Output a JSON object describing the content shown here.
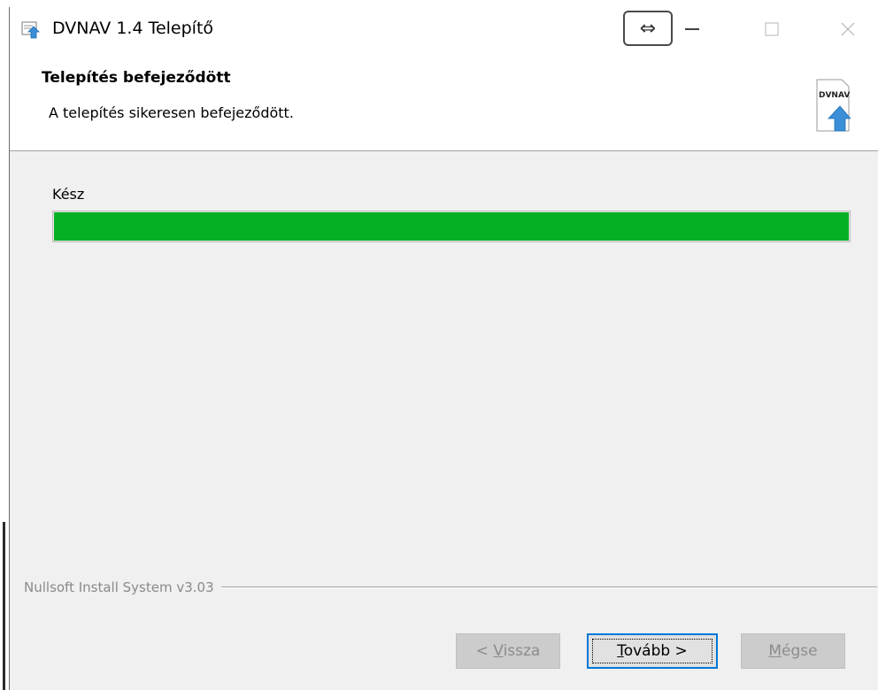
{
  "window": {
    "title": "DVNAV 1.4 Telepítő"
  },
  "titlebar": {
    "resize_toggle_glyph": "⇔",
    "icons": {
      "app": "installer-icon",
      "minimize": "minimize-icon",
      "maximize": "maximize-icon",
      "close": "close-icon"
    }
  },
  "header": {
    "title": "Telepítés befejeződött",
    "subtitle": "A telepítés sikeresen befejeződött.",
    "logo_text": "DVNAV"
  },
  "content": {
    "status_label": "Kész",
    "progress_percent": 100,
    "progress_color": "#06b025"
  },
  "footer": {
    "branding": "Nullsoft Install System v3.03",
    "buttons": {
      "back": {
        "prefix": "< ",
        "mnemonic": "V",
        "rest": "issza",
        "enabled": false
      },
      "next": {
        "mnemonic": "T",
        "rest": "ovább >",
        "enabled": true
      },
      "cancel": {
        "mnemonic": "M",
        "rest": "égse",
        "enabled": false
      }
    }
  },
  "colors": {
    "accent": "#0078d7",
    "window_bg": "#f0f0f0",
    "disabled_text": "#8c8c8c"
  }
}
